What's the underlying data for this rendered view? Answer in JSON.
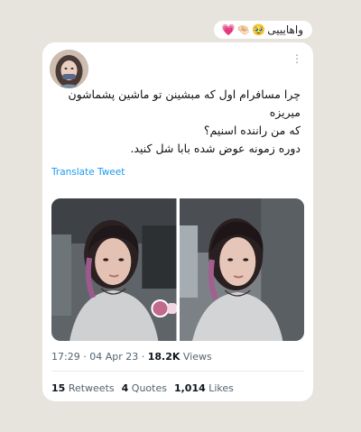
{
  "caption": {
    "text": "واهایییی",
    "emojis": [
      "🥹",
      "🤏🏻",
      "💗"
    ]
  },
  "tweet": {
    "more_label": "⋮",
    "lines": [
      "چرا مسافرام اول که مبشینن تو ماشین پشماشون میریزه",
      "که من راننده اسنیم؟",
      "دوره زمونه عوض شده بابا شل کنید."
    ],
    "translate_label": "Translate Tweet",
    "time": "17:29",
    "date": "04 Apr 23",
    "views_count": "18.2K",
    "views_label": "Views",
    "retweets_count": "15",
    "retweets_label": "Retweets",
    "quotes_count": "4",
    "quotes_label": "Quotes",
    "likes_count": "1,014",
    "likes_label": "Likes"
  },
  "colors": {
    "background": "#e7e4dd",
    "link": "#1d9bf0",
    "muted": "#536471"
  }
}
